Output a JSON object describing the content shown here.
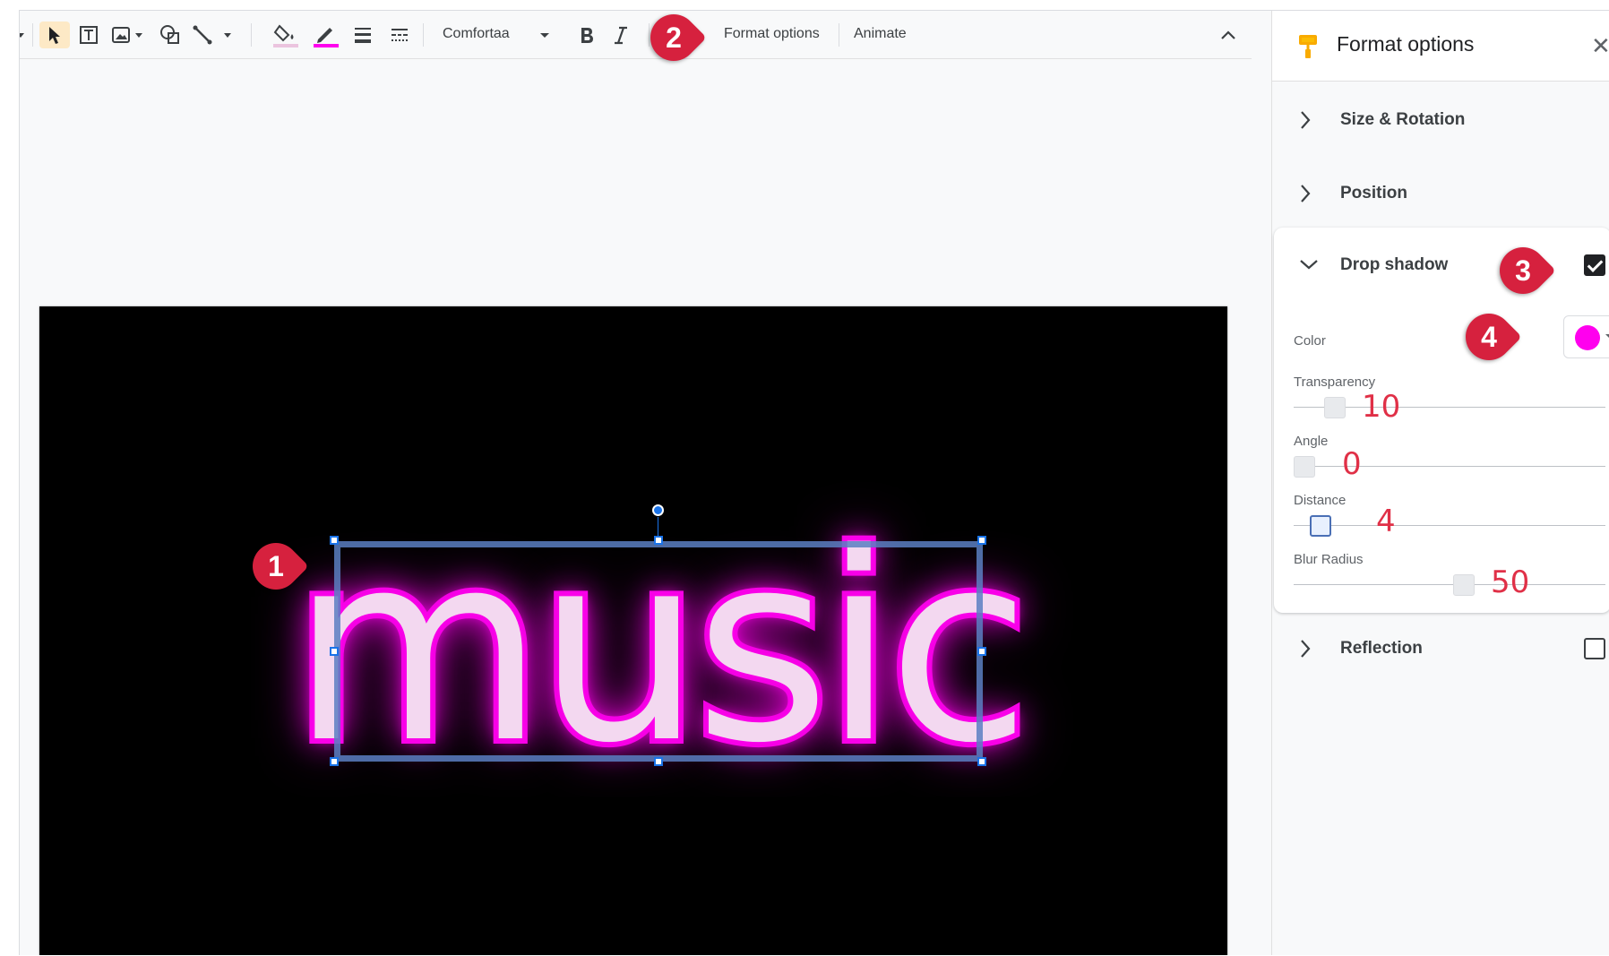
{
  "toolbar": {
    "font_name": "Comfortaa",
    "format_options": "Format options",
    "animate": "Animate"
  },
  "slide": {
    "word": "music"
  },
  "panel": {
    "title": "Format options",
    "sections": {
      "size_rotation": "Size & Rotation",
      "position": "Position",
      "drop_shadow": "Drop shadow",
      "reflection": "Reflection"
    },
    "drop_shadow": {
      "checked": true,
      "color_label": "Color",
      "color_value": "#ff00ee",
      "transparency_label": "Transparency",
      "transparency_value": "10",
      "angle_label": "Angle",
      "angle_value": "0",
      "distance_label": "Distance",
      "distance_value": "4",
      "blur_label": "Blur Radius",
      "blur_value": "50"
    },
    "reflection_checked": false
  },
  "callouts": [
    "1",
    "2",
    "3",
    "4"
  ],
  "colors": {
    "accent": "#d6213e",
    "glow": "#ff00ee",
    "selection": "#1a73e8"
  }
}
